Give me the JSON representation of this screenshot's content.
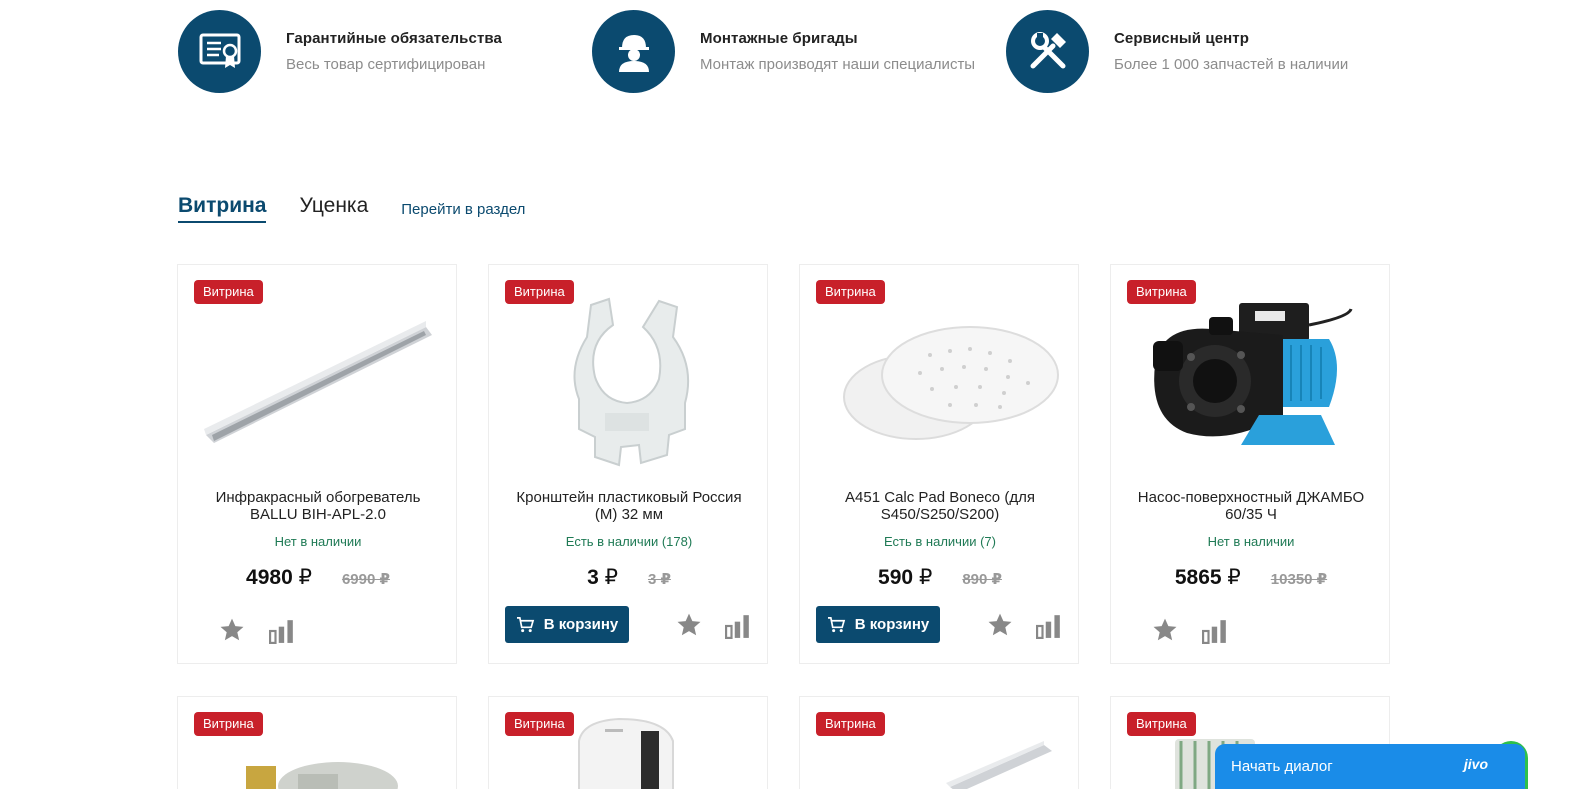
{
  "features": [
    {
      "icon": "certificate-icon",
      "title": "Гарантийные обязательства",
      "desc": "Весь товар сертифицирован"
    },
    {
      "icon": "worker-icon",
      "title": "Монтажные бригады",
      "desc": "Монтаж производят наши специалисты"
    },
    {
      "icon": "tools-icon",
      "title": "Сервисный центр",
      "desc": "Более 1 000 запчастей в наличии"
    }
  ],
  "tabs": {
    "active": "Витрина",
    "second": "Уценка",
    "link": "Перейти в раздел"
  },
  "products": [
    {
      "badge": "Витрина",
      "name": "Инфракрасный обогреватель BALLU BIH-APL-2.0",
      "availability": "Нет в наличии",
      "price": "4980",
      "currency": "₽",
      "old_price": "6990 ₽",
      "cart": ""
    },
    {
      "badge": "Витрина",
      "name": "Кронштейн пластиковый Россия (М) 32 мм",
      "availability": "Есть в наличии (178)",
      "price": "3",
      "currency": "₽",
      "old_price": "3 ₽",
      "cart": "В корзину"
    },
    {
      "badge": "Витрина",
      "name": "A451 Calc Pad Boneco (для S450/S250/S200)",
      "availability": "Есть в наличии (7)",
      "price": "590",
      "currency": "₽",
      "old_price": "890 ₽",
      "cart": "В корзину"
    },
    {
      "badge": "Витрина",
      "name": "Насос-поверхностный ДЖАМБО 60/35 Ч",
      "availability": "Нет в наличии",
      "price": "5865",
      "currency": "₽",
      "old_price": "10350 ₽",
      "cart": ""
    }
  ],
  "products_row2": [
    {
      "badge": "Витрина"
    },
    {
      "badge": "Витрина"
    },
    {
      "badge": "Витрина"
    },
    {
      "badge": "Витрина"
    }
  ],
  "chat": {
    "label": "Начать диалог",
    "brand": "jivo"
  },
  "colors": {
    "brand": "#0b4a6f",
    "badge": "#c8202a",
    "availability": "#1f7a55",
    "chat": "#1a8ce8"
  }
}
